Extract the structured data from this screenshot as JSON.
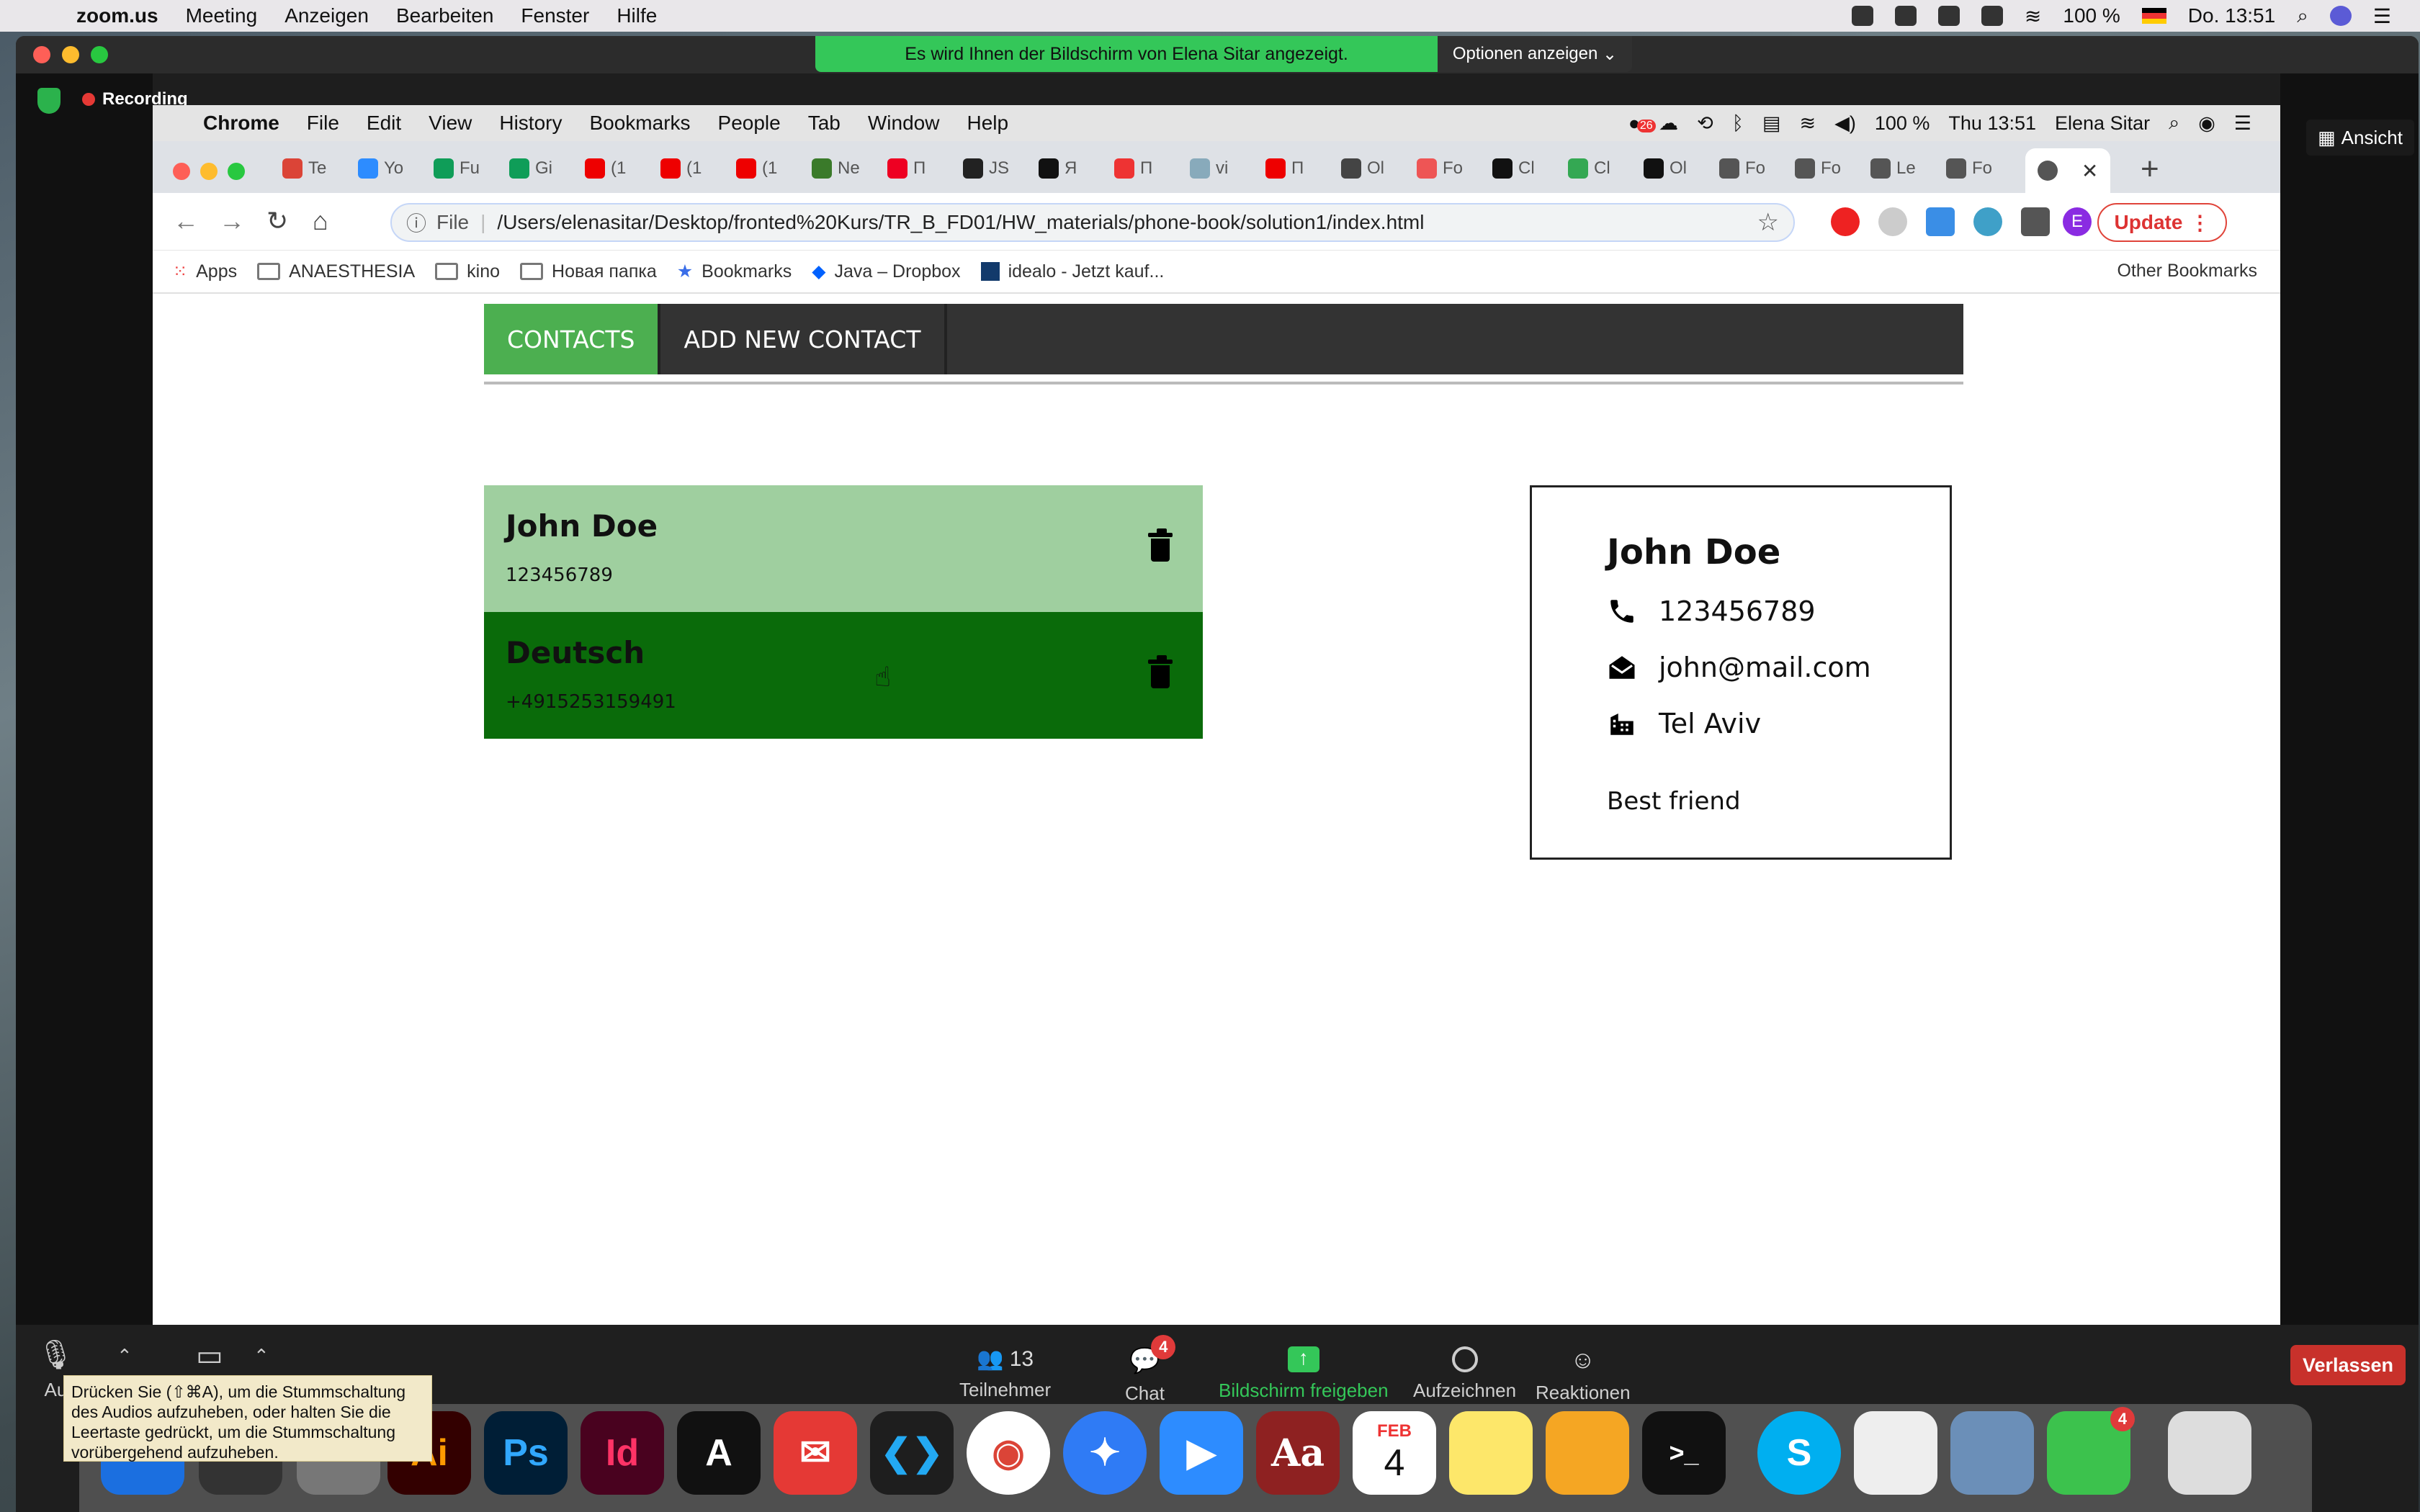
{
  "mac_menubar": {
    "app": "zoom.us",
    "items": [
      "Meeting",
      "Anzeigen",
      "Bearbeiten",
      "Fenster",
      "Hilfe"
    ],
    "battery": "100 %",
    "clock": "Do. 13:51"
  },
  "zoom": {
    "share_banner": "Es wird Ihnen der Bildschirm von Elena Sitar angezeigt.",
    "options_label": "Optionen anzeigen",
    "recording_label": "Recording",
    "view_label": "Ansicht",
    "toolbar": {
      "audio_label": "Au",
      "participants_count": "13",
      "participants_label": "Teilnehmer",
      "chat_label": "Chat",
      "chat_badge": "4",
      "share_label": "Bildschirm freigeben",
      "record_label": "Aufzeichnen",
      "reactions_label": "Reaktionen",
      "leave_label": "Verlassen"
    },
    "mute_tooltip": "Drücken Sie  (⇧⌘A), um die Stummschaltung des Audios aufzuheben, oder halten Sie die Leertaste gedrückt, um die Stummschaltung vorübergehend aufzuheben."
  },
  "chrome": {
    "menubar": {
      "app": "Chrome",
      "items": [
        "File",
        "Edit",
        "View",
        "History",
        "Bookmarks",
        "People",
        "Tab",
        "Window",
        "Help"
      ],
      "battery": "100 %",
      "clock": "Thu 13:51",
      "user": "Elena Sitar",
      "notif_badge": "26"
    },
    "tabs": [
      "Te",
      "Yo",
      "Fu",
      "Gi",
      "(1",
      "(1",
      "(1",
      "Ne",
      "П",
      "JS",
      "Я",
      "П",
      "vi",
      "П",
      "Ol",
      "Fo",
      "Cl",
      "Cl",
      "Ol",
      "Fo",
      "Fo",
      "Le",
      "Fo"
    ],
    "address": {
      "scheme": "File",
      "url": "/Users/elenasitar/Desktop/fronted%20Kurs/TR_B_FD01/HW_materials/phone-book/solution1/index.html"
    },
    "update_label": "Update",
    "profile_initial": "E",
    "bookmarks": [
      "Apps",
      "ANAESTHESIA",
      "kino",
      "Новая папка",
      "Bookmarks",
      "Java – Dropbox",
      "idealo - Jetzt kauf..."
    ],
    "other_bookmarks": "Other Bookmarks"
  },
  "app": {
    "nav": {
      "contacts": "CONTACTS",
      "add_new": "ADD NEW CONTACT"
    },
    "contacts": [
      {
        "name": "John Doe",
        "phone": "123456789"
      },
      {
        "name": "Deutsch",
        "phone": "+4915253159491"
      }
    ],
    "details": {
      "name": "John Doe",
      "phone": "123456789",
      "email": "john@mail.com",
      "city": "Tel Aviv",
      "note": "Best friend"
    }
  },
  "colors": {
    "accent_green": "#4caf50",
    "selected_contact": "#9fcf9f",
    "dark_contact": "#0a6b0a",
    "nav_dark": "#333333",
    "leave_red": "#c8312b"
  },
  "dock": {
    "facetime_badge": "4",
    "calendar_month": "FEB",
    "calendar_day": "4"
  }
}
